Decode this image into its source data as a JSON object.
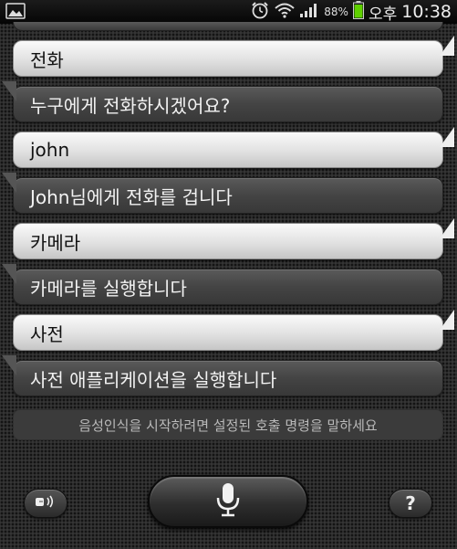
{
  "status_bar": {
    "battery_percent": "88%",
    "ampm": "오후",
    "time": "10:38",
    "icons": [
      "image-icon",
      "alarm-icon",
      "wifi-icon",
      "signal-icon",
      "battery-icon"
    ],
    "battery_color": "#5fd000"
  },
  "conversation": [
    {
      "speaker": "user",
      "text": "전화"
    },
    {
      "speaker": "assistant",
      "text": "누구에게 전화하시겠어요?"
    },
    {
      "speaker": "user",
      "text": "john"
    },
    {
      "speaker": "assistant",
      "text": "John님에게 전화를 겁니다"
    },
    {
      "speaker": "user",
      "text": "카메라"
    },
    {
      "speaker": "assistant",
      "text": "카메라를 실행합니다"
    },
    {
      "speaker": "user",
      "text": "사전"
    },
    {
      "speaker": "assistant",
      "text": "사전 애플리케이션을 실행합니다"
    }
  ],
  "hint": "음성인식을 시작하려면 설정된 호출 명령을 말하세요",
  "controls": {
    "speaker_icon": "speaker-icon",
    "mic_icon": "microphone-icon",
    "help_label": "?"
  }
}
